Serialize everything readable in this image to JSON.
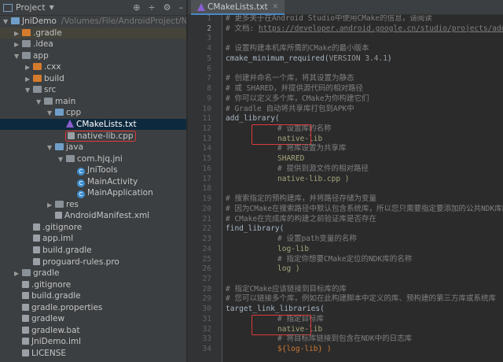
{
  "project_panel": {
    "title": "Project",
    "tools": [
      "target-icon",
      "collapse-icon",
      "gear-icon",
      "minimize-icon"
    ],
    "tree": [
      {
        "label": "JniDemo",
        "path": "/Volumes/File/AndroidProject/NDK/jni",
        "depth": 0,
        "arrow": "down",
        "icon": "module"
      },
      {
        "label": ".gradle",
        "depth": 1,
        "arrow": "right",
        "icon": "folder-orange",
        "highlight": true
      },
      {
        "label": ".idea",
        "depth": 1,
        "arrow": "right",
        "icon": "folder"
      },
      {
        "label": "app",
        "depth": 1,
        "arrow": "down",
        "icon": "folder"
      },
      {
        "label": ".cxx",
        "depth": 2,
        "arrow": "right",
        "icon": "folder-orange"
      },
      {
        "label": "build",
        "depth": 2,
        "arrow": "right",
        "icon": "folder-orange"
      },
      {
        "label": "src",
        "depth": 2,
        "arrow": "down",
        "icon": "folder"
      },
      {
        "label": "main",
        "depth": 3,
        "arrow": "down",
        "icon": "folder"
      },
      {
        "label": "cpp",
        "depth": 4,
        "arrow": "down",
        "icon": "folder-blue"
      },
      {
        "label": "CMakeLists.txt",
        "depth": 5,
        "icon": "cmake",
        "selected": true
      },
      {
        "label": "native-lib.cpp",
        "depth": 5,
        "icon": "cpp",
        "boxed": true
      },
      {
        "label": "java",
        "depth": 4,
        "arrow": "down",
        "icon": "folder-blue"
      },
      {
        "label": "com.hjq.jni",
        "depth": 5,
        "arrow": "down",
        "icon": "package"
      },
      {
        "label": "JniTools",
        "depth": 6,
        "icon": "class"
      },
      {
        "label": "MainActivity",
        "depth": 6,
        "icon": "class"
      },
      {
        "label": "MainApplication",
        "depth": 6,
        "icon": "class"
      },
      {
        "label": "res",
        "depth": 4,
        "arrow": "right",
        "icon": "folder"
      },
      {
        "label": "AndroidManifest.xml",
        "depth": 4,
        "icon": "file"
      },
      {
        "label": ".gitignore",
        "depth": 2,
        "icon": "file"
      },
      {
        "label": "app.iml",
        "depth": 2,
        "icon": "file"
      },
      {
        "label": "build.gradle",
        "depth": 2,
        "icon": "file"
      },
      {
        "label": "proguard-rules.pro",
        "depth": 2,
        "icon": "file"
      },
      {
        "label": "gradle",
        "depth": 1,
        "arrow": "right",
        "icon": "folder"
      },
      {
        "label": ".gitignore",
        "depth": 1,
        "icon": "file"
      },
      {
        "label": "build.gradle",
        "depth": 1,
        "icon": "file"
      },
      {
        "label": "gradle.properties",
        "depth": 1,
        "icon": "file"
      },
      {
        "label": "gradlew",
        "depth": 1,
        "icon": "file"
      },
      {
        "label": "gradlew.bat",
        "depth": 1,
        "icon": "file"
      },
      {
        "label": "JniDemo.iml",
        "depth": 1,
        "icon": "file"
      },
      {
        "label": "LICENSE",
        "depth": 1,
        "icon": "file"
      }
    ]
  },
  "editor": {
    "tab": "CMakeLists.txt",
    "current_line": 2,
    "lines": [
      {
        "t": "# 更多关于在Android Studio中使用CMake的信息，请阅读",
        "k": "c"
      },
      {
        "t": "# 文档: ",
        "k": "c",
        "url": "https://developer.android.google.cn/studio/projects/add-native-code"
      },
      {
        "t": "",
        "k": ""
      },
      {
        "t": "# 设置构建本机库所需的CMake的最小版本",
        "k": "c"
      },
      {
        "t": "cmake_minimum_required(",
        "k": "f",
        "arg": "VERSION 3.4.1",
        "end": ")"
      },
      {
        "t": "",
        "k": ""
      },
      {
        "t": "# 创建并命名一个库，将其设置为静态",
        "k": "c"
      },
      {
        "t": "# 或 SHARED，并提供源代码的相对路径",
        "k": "c"
      },
      {
        "t": "# 你可以定义多个库，CMake为你构建它们",
        "k": "c"
      },
      {
        "t": "# Gradle 自动将共享库打包到APK中",
        "k": "c"
      },
      {
        "t": "add_library(",
        "k": "f"
      },
      {
        "t": "# 设置库的名称",
        "k": "c",
        "indent": true,
        "box": "start"
      },
      {
        "t": "native-lib",
        "k": "g",
        "indent": true,
        "box": "end"
      },
      {
        "t": "# 将库设置为共享库",
        "k": "c",
        "indent": true
      },
      {
        "t": "SHARED",
        "k": "g",
        "indent": true
      },
      {
        "t": "# 提供到源文件的相对路径",
        "k": "c",
        "indent": true
      },
      {
        "t": "native-lib.cpp )",
        "k": "g",
        "indent": true
      },
      {
        "t": "",
        "k": ""
      },
      {
        "t": "# 搜索指定的预构建库，并将路径存储为变量",
        "k": "c"
      },
      {
        "t": "# 因为CMake在搜索路径中默认包含系统库，所以您只需要指定要添加的公共NDK库的名称",
        "k": "c"
      },
      {
        "t": "# CMake在完成库的构建之前验证库是否存在",
        "k": "c"
      },
      {
        "t": "find_library(",
        "k": "f"
      },
      {
        "t": "# 设置path变量的名称",
        "k": "c",
        "indent": true
      },
      {
        "t": "log-lib",
        "k": "g",
        "indent": true
      },
      {
        "t": "# 指定你想要CMake定位的NDK库的名称",
        "k": "c",
        "indent": true
      },
      {
        "t": "log )",
        "k": "g",
        "indent": true
      },
      {
        "t": "",
        "k": ""
      },
      {
        "t": "# 指定CMake应该链接到目标库的库",
        "k": "c"
      },
      {
        "t": "# 您可以链接多个库，例如在此构建脚本中定义的库、预构建的第三方库或系统库",
        "k": "c"
      },
      {
        "t": "target_link_libraries(",
        "k": "f"
      },
      {
        "t": "# 指定目标库",
        "k": "c",
        "indent": true,
        "box": "start"
      },
      {
        "t": "native-lib",
        "k": "g",
        "indent": true,
        "box": "end"
      },
      {
        "t": "# 将目标库链接到包含在NDK中的日志库",
        "k": "c",
        "indent": true
      },
      {
        "t": "${log-lib} )",
        "k": "o",
        "indent": true
      }
    ]
  }
}
